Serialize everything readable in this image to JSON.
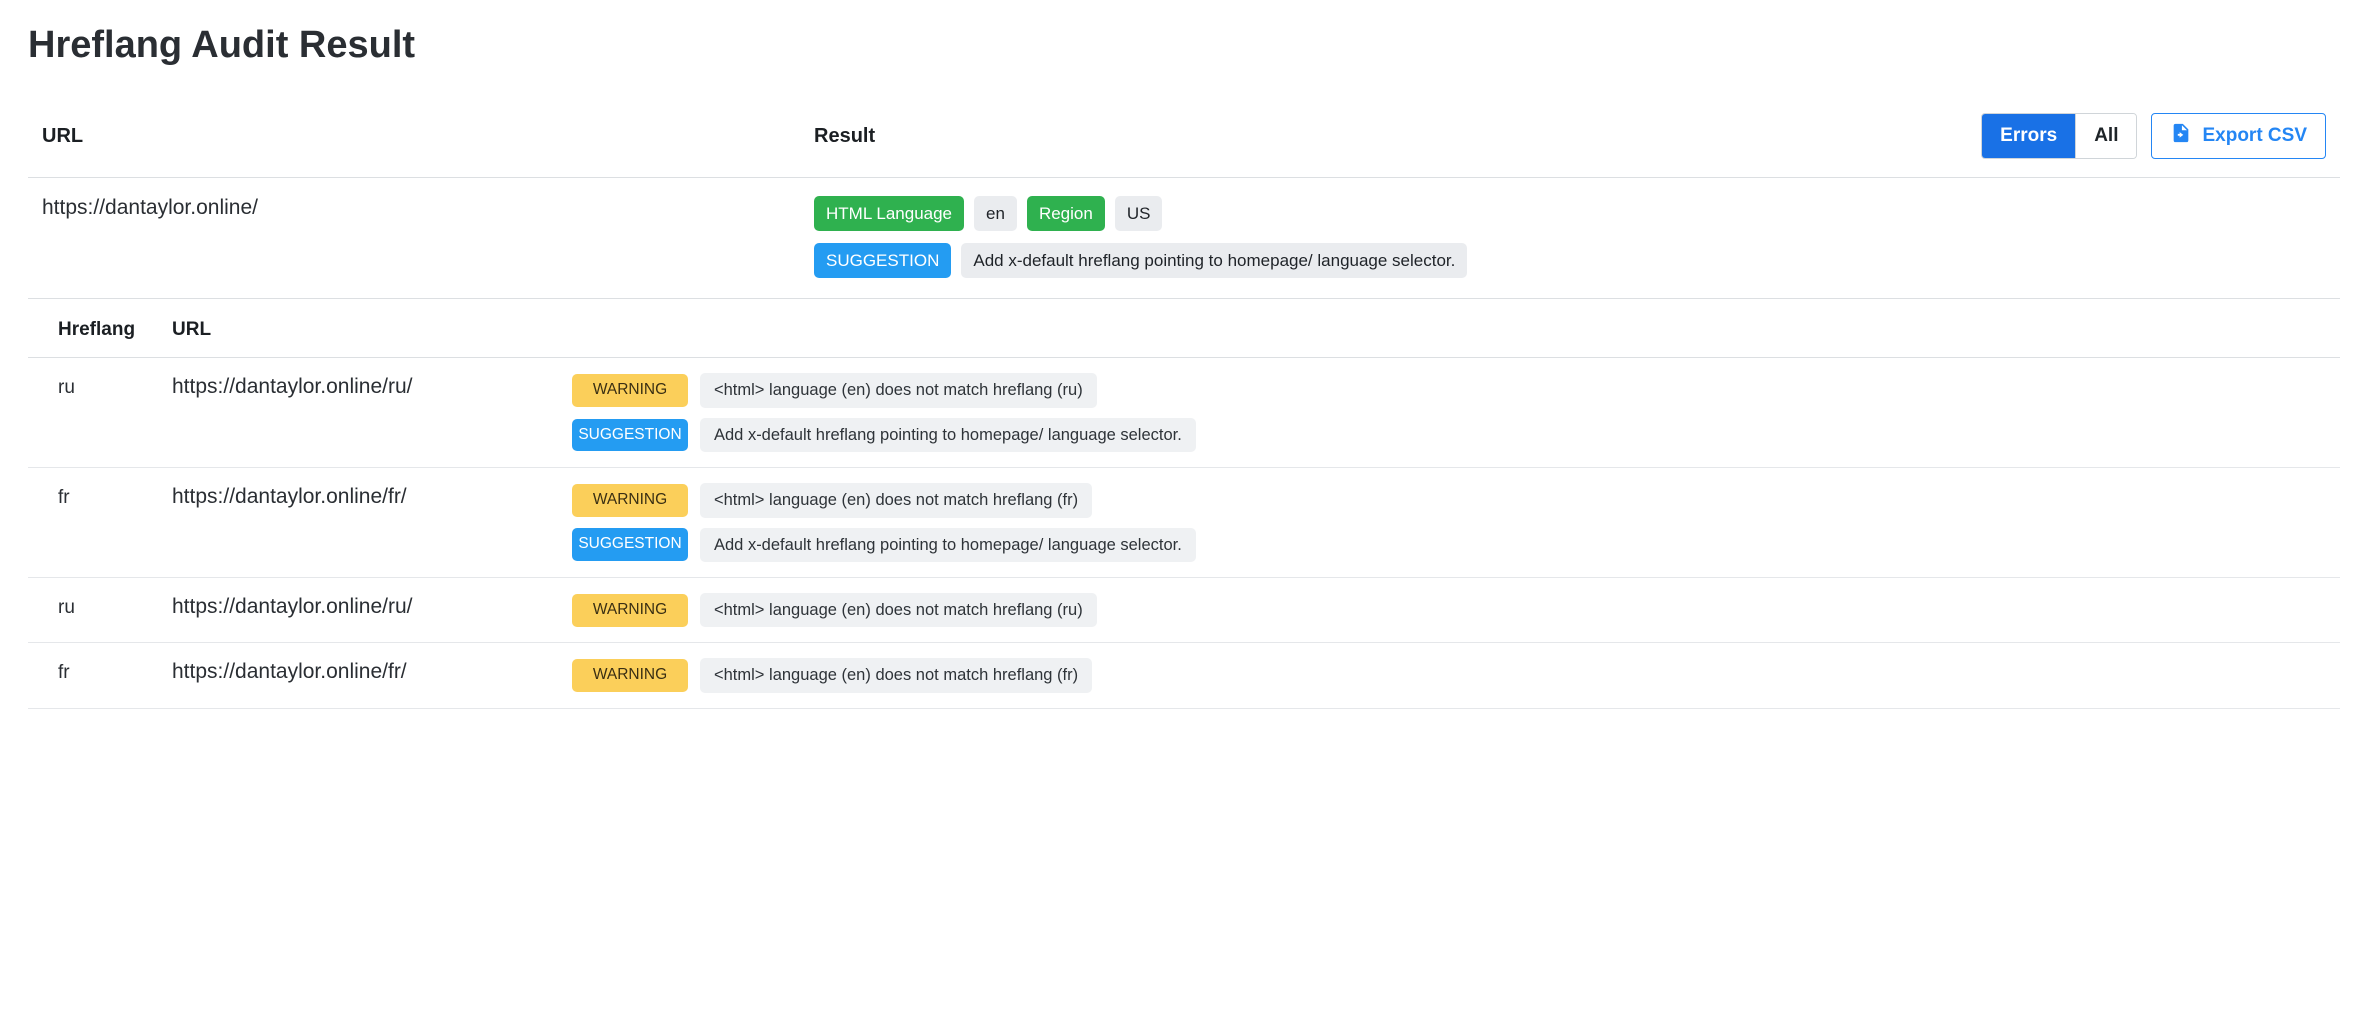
{
  "title": "Hreflang Audit Result",
  "columns": {
    "url": "URL",
    "result": "Result"
  },
  "controls": {
    "toggle": {
      "errors": "Errors",
      "all": "All",
      "active": "errors"
    },
    "export": "Export CSV"
  },
  "main": {
    "url": "https://dantaylor.online/",
    "info": [
      {
        "type": "green",
        "text": "HTML Language"
      },
      {
        "type": "grey",
        "text": "en"
      },
      {
        "type": "green",
        "text": "Region"
      },
      {
        "type": "grey",
        "text": "US"
      }
    ],
    "extra": {
      "label": "SUGGESTION",
      "text": "Add x-default hreflang pointing to homepage/ language selector."
    }
  },
  "sub_columns": {
    "hreflang": "Hreflang",
    "url": "URL"
  },
  "rows": [
    {
      "hreflang": "ru",
      "url": "https://dantaylor.online/ru/",
      "messages": [
        {
          "kind": "warning",
          "label": "WARNING",
          "text": "<html> language (en) does not match hreflang (ru)"
        },
        {
          "kind": "suggestion",
          "label": "SUGGESTION",
          "text": "Add x-default hreflang pointing to homepage/ language selector."
        }
      ]
    },
    {
      "hreflang": "fr",
      "url": "https://dantaylor.online/fr/",
      "messages": [
        {
          "kind": "warning",
          "label": "WARNING",
          "text": "<html> language (en) does not match hreflang (fr)"
        },
        {
          "kind": "suggestion",
          "label": "SUGGESTION",
          "text": "Add x-default hreflang pointing to homepage/ language selector."
        }
      ]
    },
    {
      "hreflang": "ru",
      "url": "https://dantaylor.online/ru/",
      "messages": [
        {
          "kind": "warning",
          "label": "WARNING",
          "text": "<html> language (en) does not match hreflang (ru)"
        }
      ]
    },
    {
      "hreflang": "fr",
      "url": "https://dantaylor.online/fr/",
      "messages": [
        {
          "kind": "warning",
          "label": "WARNING",
          "text": "<html> language (en) does not match hreflang (fr)"
        }
      ]
    }
  ]
}
